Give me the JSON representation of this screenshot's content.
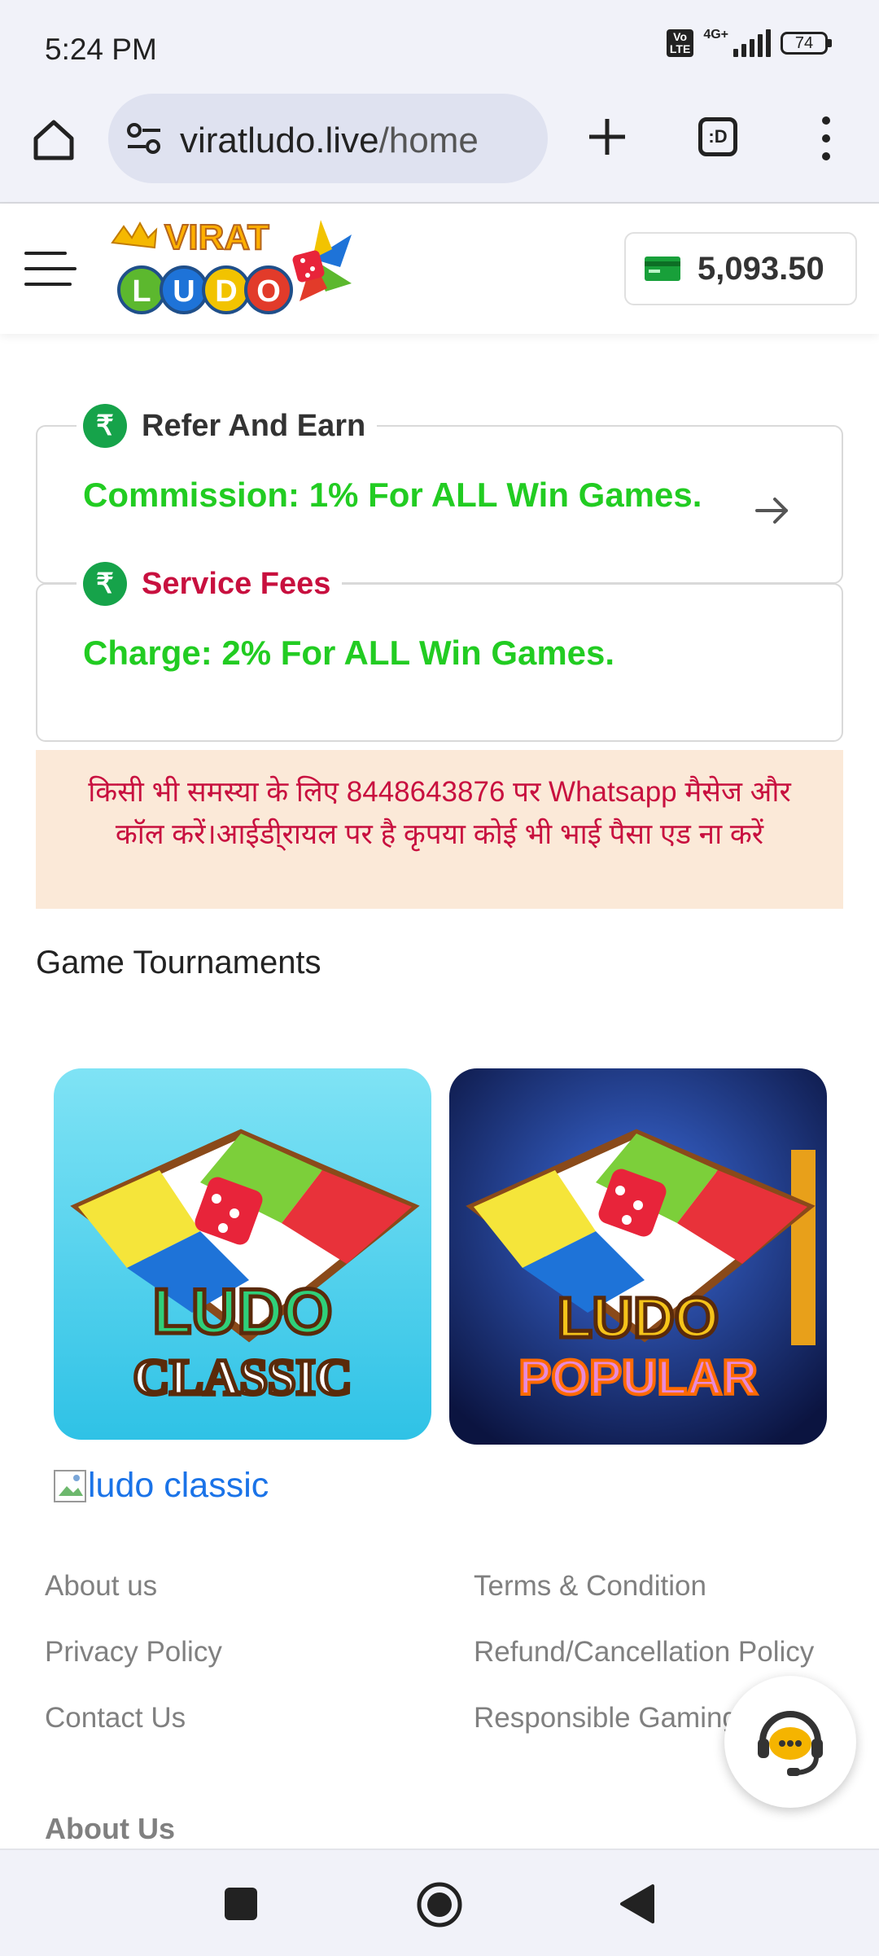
{
  "status_bar": {
    "time": "5:24 PM",
    "volte_label": "Vo\nLTE",
    "network": "4G+",
    "battery": "74"
  },
  "browser": {
    "url_domain": "viratludo.live",
    "url_path": "/home",
    "tabs_label": ":D"
  },
  "header": {
    "logo_top_text": "VIRAT",
    "logo_bottom_letters": [
      "L",
      "U",
      "D",
      "O"
    ],
    "wallet_balance": "5,093.50"
  },
  "refer_card": {
    "icon": "₹",
    "title": "Refer And Earn",
    "body": "Commission: 1% For ALL Win Games."
  },
  "fees_card": {
    "icon": "₹",
    "title": "Service Fees",
    "body": "Charge: 2% For ALL Win Games."
  },
  "notice": {
    "line1": "किसी भी समस्या के लिए 8448643876  पर Whatsapp मैसेज और",
    "line2": "कॉल करें।आईडी्रायल पर है कृपया कोई भी भाई पैसा एड ना करें"
  },
  "tournaments": {
    "title": "Game Tournaments",
    "games": [
      {
        "name": "ludo-classic",
        "line1": "LUDO",
        "line2": "CLASSIC"
      },
      {
        "name": "ludo-popular",
        "line1": "LUDO",
        "line2": "POPULAR"
      }
    ],
    "broken_image_alt": "ludo classic"
  },
  "footer": {
    "links_left": [
      "About us",
      "Privacy Policy",
      "Contact Us"
    ],
    "links_right": [
      "Terms & Condition",
      "Refund/Cancellation Policy",
      "Responsible Gaming"
    ],
    "about_heading": "About Us"
  },
  "colors": {
    "green_text": "#22cc22",
    "red_text": "#c8103f",
    "badge_green": "#16a34a",
    "notice_bg": "#fbe9d8"
  },
  "icons": [
    "home-icon",
    "site-settings-icon",
    "plus-icon",
    "tabs-icon",
    "more-icon",
    "hamburger-icon",
    "wallet-icon",
    "rupee-icon",
    "arrow-right-icon",
    "broken-image-icon",
    "support-chat-icon",
    "nav-recents-icon",
    "nav-home-icon",
    "nav-back-icon"
  ]
}
